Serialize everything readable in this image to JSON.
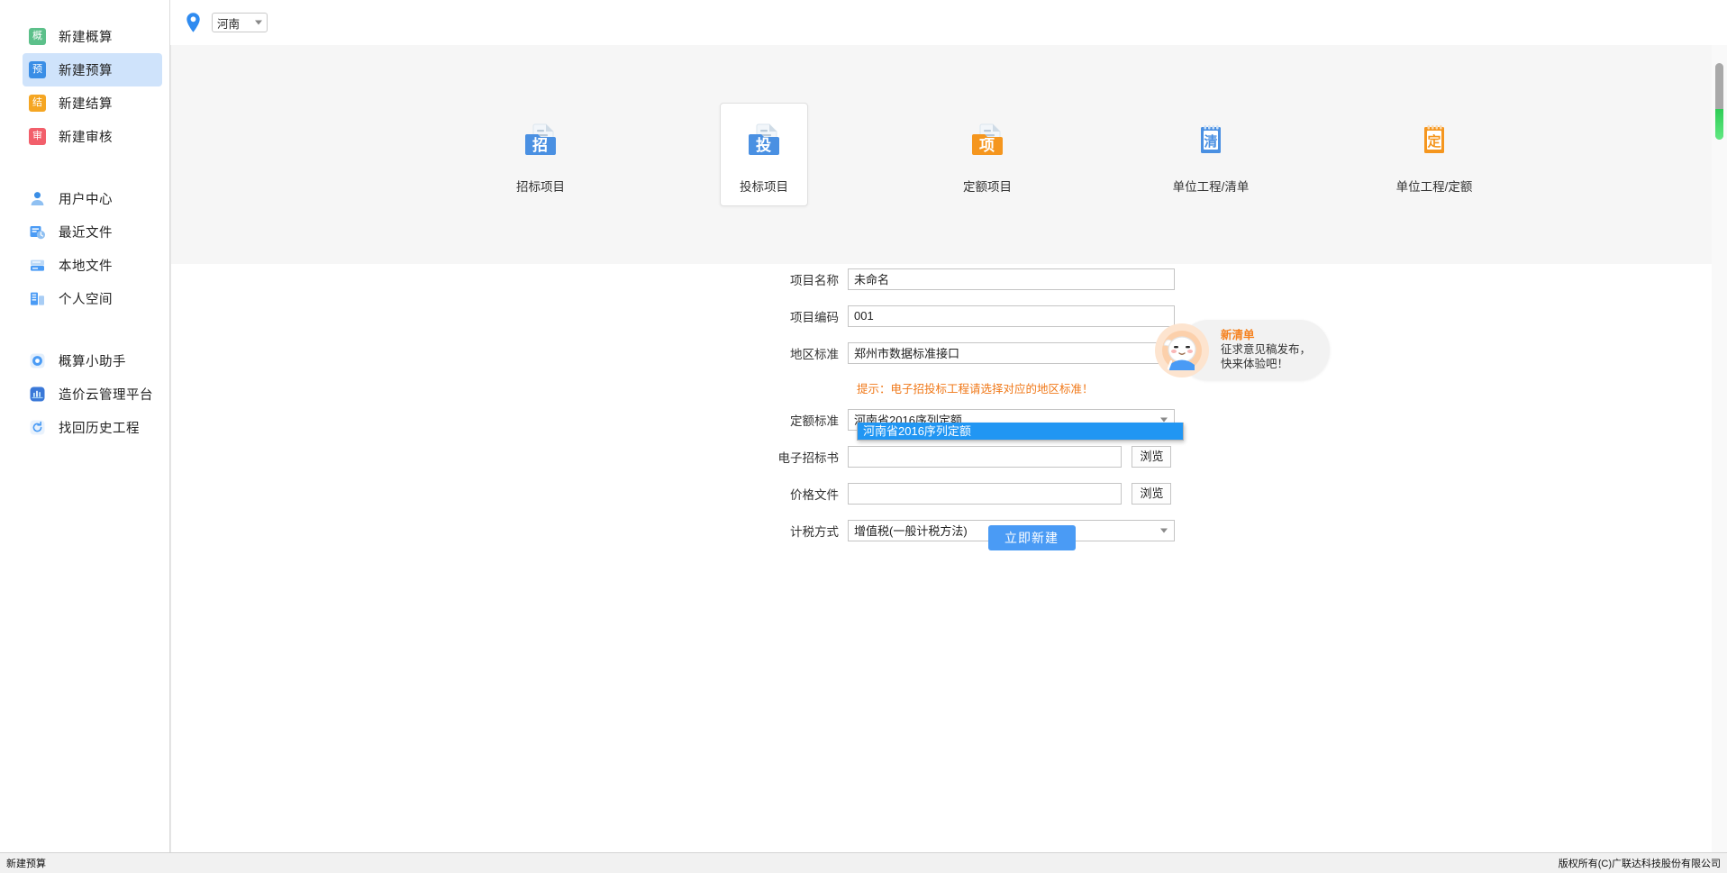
{
  "window": {
    "title": "新建预算"
  },
  "sidebar": {
    "primary_items": [
      {
        "label": "新建概算",
        "glyph": "概",
        "color": "#5cc08a",
        "id": "new-estimate"
      },
      {
        "label": "新建预算",
        "glyph": "预",
        "color": "#3a8ee6",
        "id": "new-budget",
        "active": true
      },
      {
        "label": "新建结算",
        "glyph": "结",
        "color": "#f5a623",
        "id": "new-settlement"
      },
      {
        "label": "新建审核",
        "glyph": "审",
        "color": "#f25f6b",
        "id": "new-audit"
      }
    ],
    "secondary_items": [
      {
        "label": "用户中心",
        "icon": "user-icon"
      },
      {
        "label": "最近文件",
        "icon": "recent-files-icon"
      },
      {
        "label": "本地文件",
        "icon": "local-files-icon"
      },
      {
        "label": "个人空间",
        "icon": "personal-space-icon"
      }
    ],
    "tertiary_items": [
      {
        "label": "概算小助手",
        "icon": "assistant-icon"
      },
      {
        "label": "造价云管理平台",
        "icon": "cloud-platform-icon"
      },
      {
        "label": "找回历史工程",
        "icon": "history-recover-icon"
      }
    ]
  },
  "topbar": {
    "pin_icon": "location-pin-icon",
    "region_value": "河南"
  },
  "templates": [
    {
      "label": "招标项目",
      "glyph": "招",
      "color": "#4a90e2",
      "kind": "folder",
      "selected": false
    },
    {
      "label": "投标项目",
      "glyph": "投",
      "color": "#4a90e2",
      "kind": "folder",
      "selected": true
    },
    {
      "label": "定额项目",
      "glyph": "项",
      "color": "#f5961e",
      "kind": "folder",
      "selected": false
    },
    {
      "label": "单位工程/清单",
      "glyph": "清",
      "color": "#4a90e2",
      "kind": "pad",
      "selected": false
    },
    {
      "label": "单位工程/定额",
      "glyph": "定",
      "color": "#f5961e",
      "kind": "pad",
      "selected": false
    }
  ],
  "form": {
    "fields": [
      {
        "label": "项目名称",
        "value": "未命名",
        "type": "text"
      },
      {
        "label": "项目编码",
        "value": "001",
        "type": "text"
      },
      {
        "label": "地区标准",
        "value": "郑州市数据标准接口",
        "type": "select"
      }
    ],
    "hint": "提示：电子招投标工程请选择对应的地区标准！",
    "quota_label": "定额标准",
    "quota_value": "河南省2016序列定额",
    "quota_options": [
      "河南省2016序列定额"
    ],
    "file_fields": [
      {
        "label": "电子招标书",
        "value": "",
        "button": "浏览"
      },
      {
        "label": "价格文件",
        "value": "",
        "button": "浏览"
      }
    ],
    "tax_label": "计税方式",
    "tax_value": "增值税(一般计税方法)",
    "submit_label": "立即新建"
  },
  "mascot": {
    "title": "新清单",
    "line1": "征求意见稿发布，",
    "line2": "快来体验吧！"
  },
  "statusbar": {
    "left": "新建预算",
    "right": "版权所有(C)广联达科技股份有限公司"
  },
  "colors": {
    "accent": "#4a9bf5",
    "hint": "#f07818",
    "selected_option_bg": "#2196f3",
    "sidebar_active_bg": "#cfe3fb"
  }
}
